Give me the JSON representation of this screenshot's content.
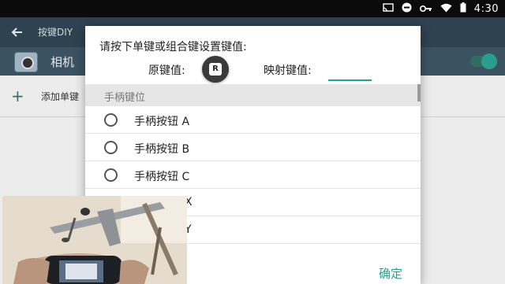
{
  "status_bar": {
    "icons": [
      "cast-icon",
      "dnd-icon",
      "vpn-key-icon",
      "wifi-icon",
      "battery-icon"
    ],
    "time": "4:30"
  },
  "app_bar": {
    "title": "按键DIY"
  },
  "app_row": {
    "label": "相机",
    "toggle_on": true
  },
  "add_row": {
    "label": "添加单键"
  },
  "dialog": {
    "prompt": "请按下单键或组合键设置键值:",
    "original_label": "原键值:",
    "original_key": "R",
    "mapped_label": "映射键值:",
    "mapped_value": "",
    "section_title": "手柄键位",
    "options": [
      "手柄按钮 A",
      "手柄按钮 B",
      "手柄按钮 C",
      "X",
      "Y"
    ],
    "confirm_label": "确定"
  },
  "colors": {
    "accent": "#2a9d8f",
    "app_bar": "#2f4250",
    "app_row": "#3b5262"
  }
}
